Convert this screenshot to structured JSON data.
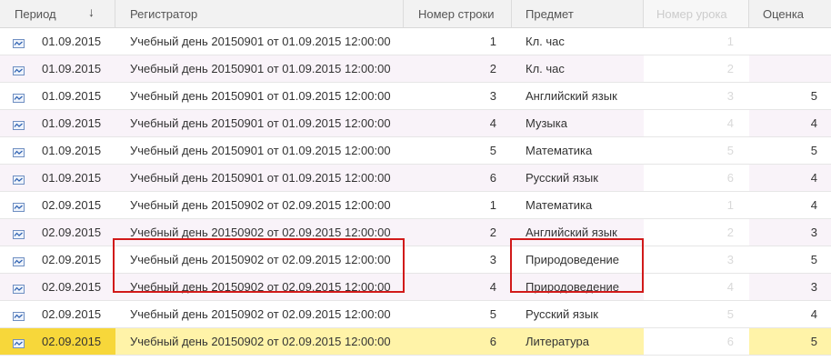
{
  "headers": {
    "period": "Период",
    "sort_indicator": "↓",
    "registrar": "Регистратор",
    "line_number": "Номер строки",
    "subject": "Предмет",
    "lesson_number": "Номер урока",
    "grade": "Оценка"
  },
  "rows": [
    {
      "period": "01.09.2015",
      "registrar": "Учебный день 20150901 от 01.09.2015 12:00:00",
      "line": "1",
      "subject": "Кл. час",
      "lesson": "1",
      "grade": ""
    },
    {
      "period": "01.09.2015",
      "registrar": "Учебный день 20150901 от 01.09.2015 12:00:00",
      "line": "2",
      "subject": "Кл. час",
      "lesson": "2",
      "grade": ""
    },
    {
      "period": "01.09.2015",
      "registrar": "Учебный день 20150901 от 01.09.2015 12:00:00",
      "line": "3",
      "subject": "Английский язык",
      "lesson": "3",
      "grade": "5"
    },
    {
      "period": "01.09.2015",
      "registrar": "Учебный день 20150901 от 01.09.2015 12:00:00",
      "line": "4",
      "subject": "Музыка",
      "lesson": "4",
      "grade": "4"
    },
    {
      "period": "01.09.2015",
      "registrar": "Учебный день 20150901 от 01.09.2015 12:00:00",
      "line": "5",
      "subject": "Математика",
      "lesson": "5",
      "grade": "5"
    },
    {
      "period": "01.09.2015",
      "registrar": "Учебный день 20150901 от 01.09.2015 12:00:00",
      "line": "6",
      "subject": "Русский язык",
      "lesson": "6",
      "grade": "4"
    },
    {
      "period": "02.09.2015",
      "registrar": "Учебный день 20150902 от 02.09.2015 12:00:00",
      "line": "1",
      "subject": "Математика",
      "lesson": "1",
      "grade": "4"
    },
    {
      "period": "02.09.2015",
      "registrar": "Учебный день 20150902 от 02.09.2015 12:00:00",
      "line": "2",
      "subject": "Английский язык",
      "lesson": "2",
      "grade": "3"
    },
    {
      "period": "02.09.2015",
      "registrar": "Учебный день 20150902 от 02.09.2015 12:00:00",
      "line": "3",
      "subject": "Природоведение",
      "lesson": "3",
      "grade": "5"
    },
    {
      "period": "02.09.2015",
      "registrar": "Учебный день 20150902 от 02.09.2015 12:00:00",
      "line": "4",
      "subject": "Природоведение",
      "lesson": "4",
      "grade": "3"
    },
    {
      "period": "02.09.2015",
      "registrar": "Учебный день 20150902 от 02.09.2015 12:00:00",
      "line": "5",
      "subject": "Русский язык",
      "lesson": "5",
      "grade": "4"
    },
    {
      "period": "02.09.2015",
      "registrar": "Учебный день 20150902 от 02.09.2015 12:00:00",
      "line": "6",
      "subject": "Литература",
      "lesson": "6",
      "grade": "5"
    }
  ],
  "selected_row_index": 11,
  "row_icon": "register-record-icon",
  "colors": {
    "selected_row": "#fff3a8",
    "selected_cell": "#f7d73a",
    "highlight_border": "#d11a1a",
    "alt_row": "#f9f3f9"
  }
}
